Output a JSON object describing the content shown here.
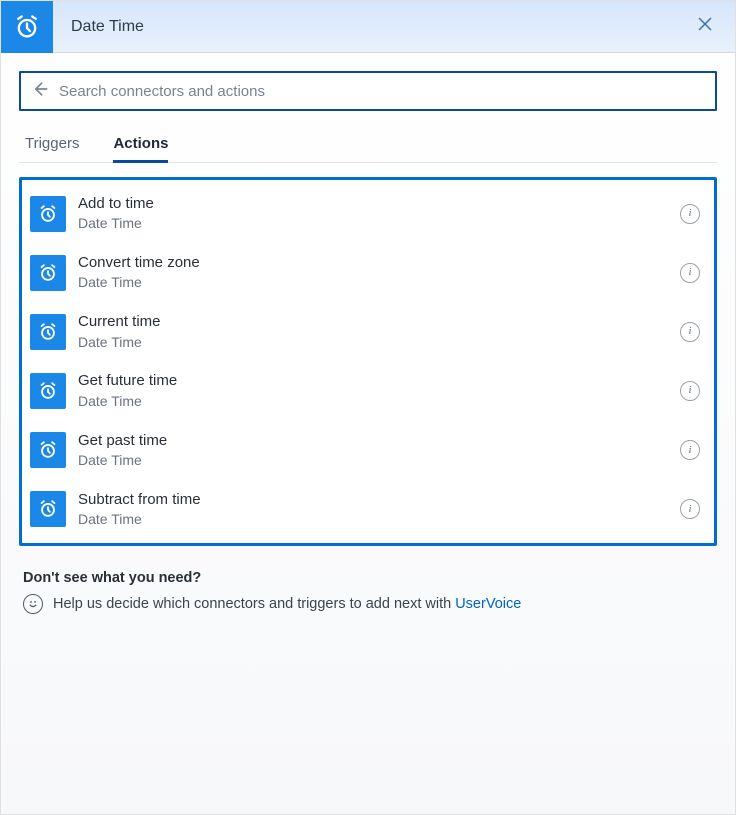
{
  "header": {
    "title": "Date Time"
  },
  "search": {
    "placeholder": "Search connectors and actions",
    "value": ""
  },
  "tabs": [
    {
      "label": "Triggers",
      "active": false
    },
    {
      "label": "Actions",
      "active": true
    }
  ],
  "actions": [
    {
      "title": "Add to time",
      "subtitle": "Date Time"
    },
    {
      "title": "Convert time zone",
      "subtitle": "Date Time"
    },
    {
      "title": "Current time",
      "subtitle": "Date Time"
    },
    {
      "title": "Get future time",
      "subtitle": "Date Time"
    },
    {
      "title": "Get past time",
      "subtitle": "Date Time"
    },
    {
      "title": "Subtract from time",
      "subtitle": "Date Time"
    }
  ],
  "help": {
    "heading": "Don't see what you need?",
    "text_prefix": "Help us decide which connectors and triggers to add next with ",
    "link_text": "UserVoice"
  },
  "icons": {
    "info_glyph": "i"
  },
  "colors": {
    "accent": "#1b87e6",
    "frame": "#006dd1",
    "header_bg": "#d6e6fa"
  }
}
